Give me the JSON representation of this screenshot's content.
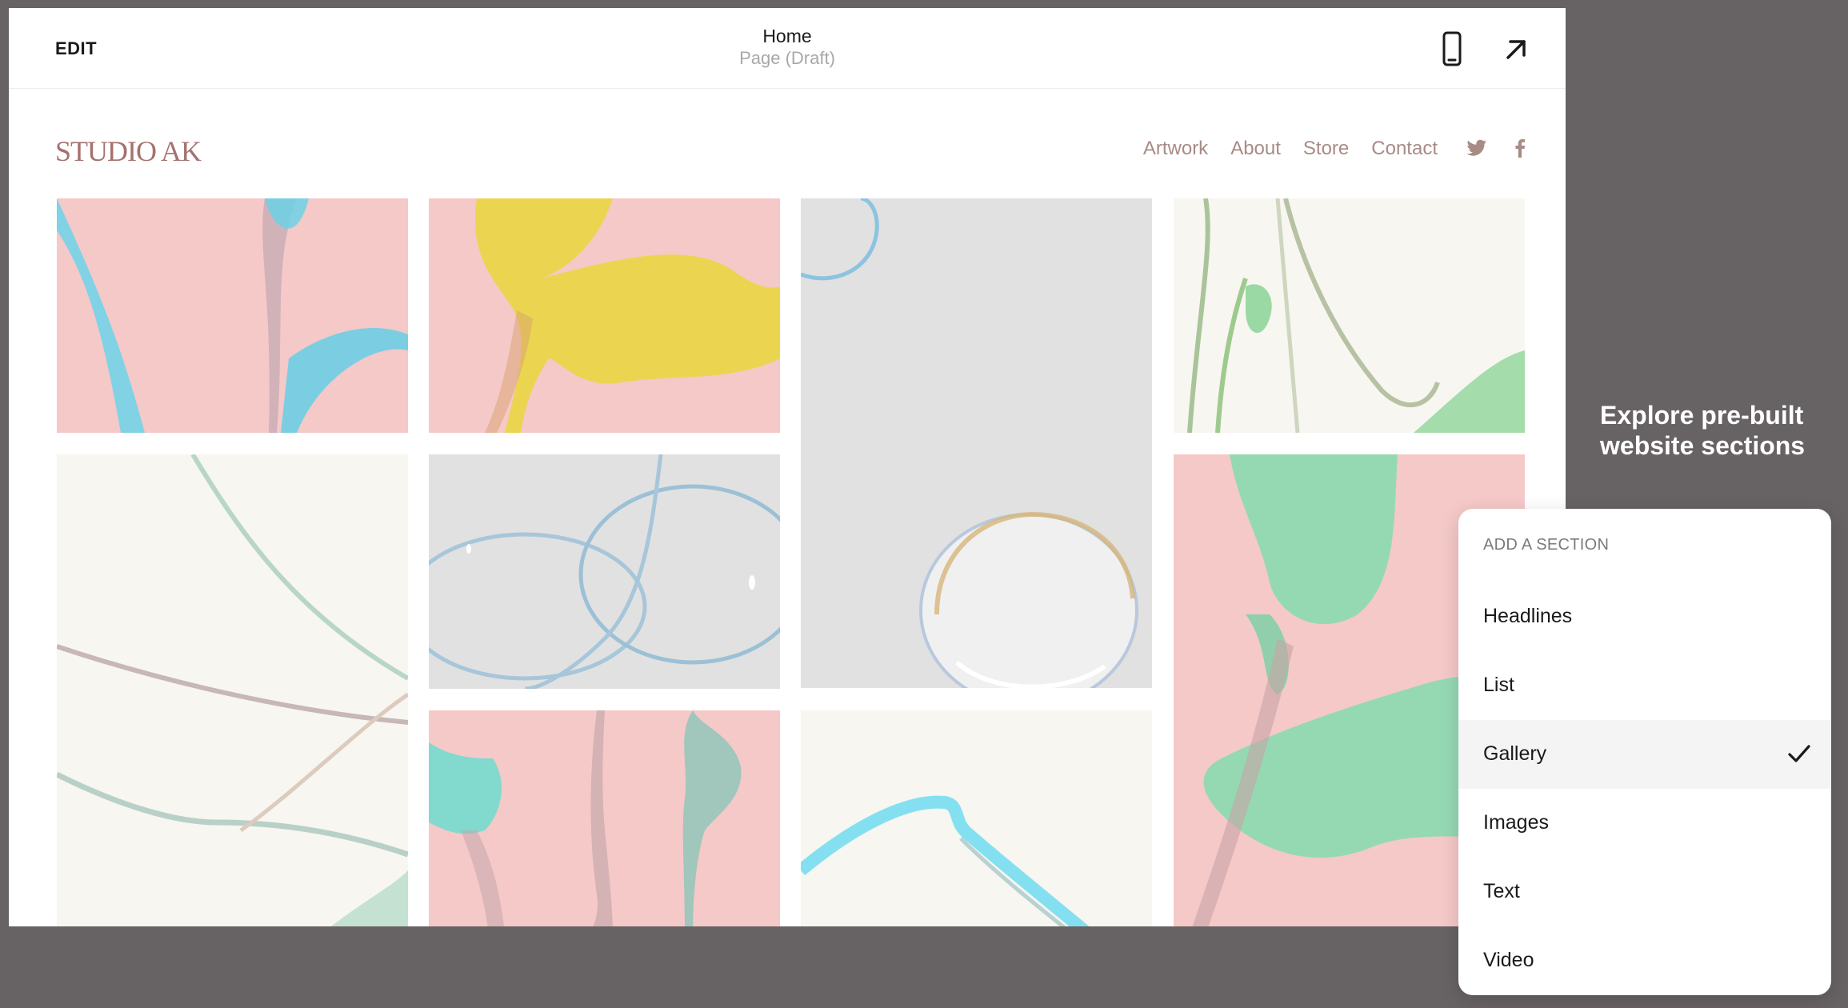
{
  "editor": {
    "edit_label": "EDIT",
    "page_title": "Home",
    "page_status": "Page (Draft)",
    "icons": [
      "mobile-preview-icon",
      "open-external-icon"
    ]
  },
  "site": {
    "logo": "STUDIO AK",
    "nav": [
      "Artwork",
      "About",
      "Store",
      "Contact"
    ],
    "social": [
      "twitter-icon",
      "facebook-icon"
    ]
  },
  "promo": {
    "line1": "Explore pre-built",
    "line2": "website sections"
  },
  "panel": {
    "heading": "ADD A SECTION",
    "options": [
      {
        "label": "Headlines",
        "selected": false
      },
      {
        "label": "List",
        "selected": false
      },
      {
        "label": "Gallery",
        "selected": true
      },
      {
        "label": "Images",
        "selected": false
      },
      {
        "label": "Text",
        "selected": false
      },
      {
        "label": "Video",
        "selected": false
      }
    ]
  },
  "colors": {
    "backdrop": "#676263",
    "logo": "#a5716e",
    "nav": "#a88b86",
    "tile_pink": "#f4c9c8",
    "tile_gray": "#e1e1e1",
    "tile_cream": "#f7f6f0"
  }
}
